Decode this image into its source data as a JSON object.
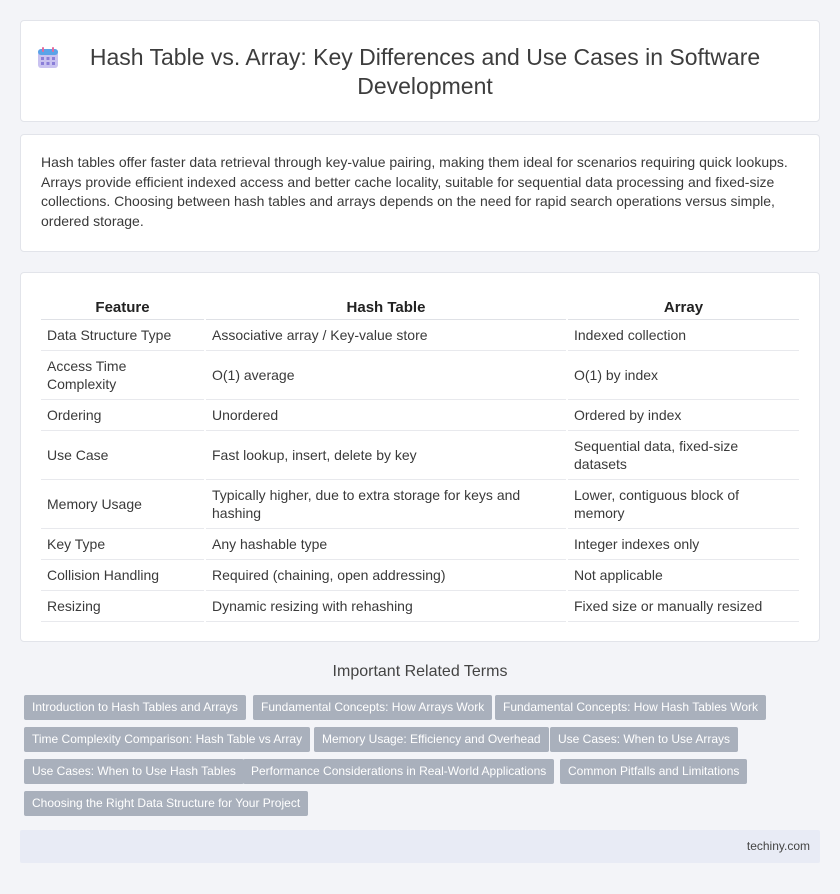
{
  "header": {
    "title": "Hash Table vs. Array: Key Differences and Use Cases in Software Development",
    "icon": "calendar-grid-icon"
  },
  "intro": {
    "text": "Hash tables offer faster data retrieval through key-value pairing, making them ideal for scenarios requiring quick lookups. Arrays provide efficient indexed access and better cache locality, suitable for sequential data processing and fixed-size collections. Choosing between hash tables and arrays depends on the need for rapid search operations versus simple, ordered storage."
  },
  "table": {
    "headers": [
      "Feature",
      "Hash Table",
      "Array"
    ],
    "rows": [
      [
        "Data Structure Type",
        "Associative array / Key-value store",
        "Indexed collection"
      ],
      [
        "Access Time Complexity",
        "O(1) average",
        "O(1) by index"
      ],
      [
        "Ordering",
        "Unordered",
        "Ordered by index"
      ],
      [
        "Use Case",
        "Fast lookup, insert, delete by key",
        "Sequential data, fixed-size datasets"
      ],
      [
        "Memory Usage",
        "Typically higher, due to extra storage for keys and hashing",
        "Lower, contiguous block of memory"
      ],
      [
        "Key Type",
        "Any hashable type",
        "Integer indexes only"
      ],
      [
        "Collision Handling",
        "Required (chaining, open addressing)",
        "Not applicable"
      ],
      [
        "Resizing",
        "Dynamic resizing with rehashing",
        "Fixed size or manually resized"
      ]
    ]
  },
  "related": {
    "title": "Important Related Terms",
    "items": [
      "Introduction to Hash Tables and Arrays",
      "Fundamental Concepts: How Arrays Work",
      "Fundamental Concepts: How Hash Tables Work",
      "Time Complexity Comparison: Hash Table vs Array",
      "Memory Usage: Efficiency and Overhead",
      "Use Cases: When to Use Arrays",
      "Use Cases: When to Use Hash Tables",
      "Performance Considerations in Real-World Applications",
      "Common Pitfalls and Limitations",
      "Choosing the Right Data Structure for Your Project"
    ]
  },
  "footer": {
    "site": "techiny.com"
  },
  "colors": {
    "chip_bg": "#a9b0bc",
    "page_bg": "#f3f4f8",
    "footer_bg": "#e8ebf5"
  }
}
